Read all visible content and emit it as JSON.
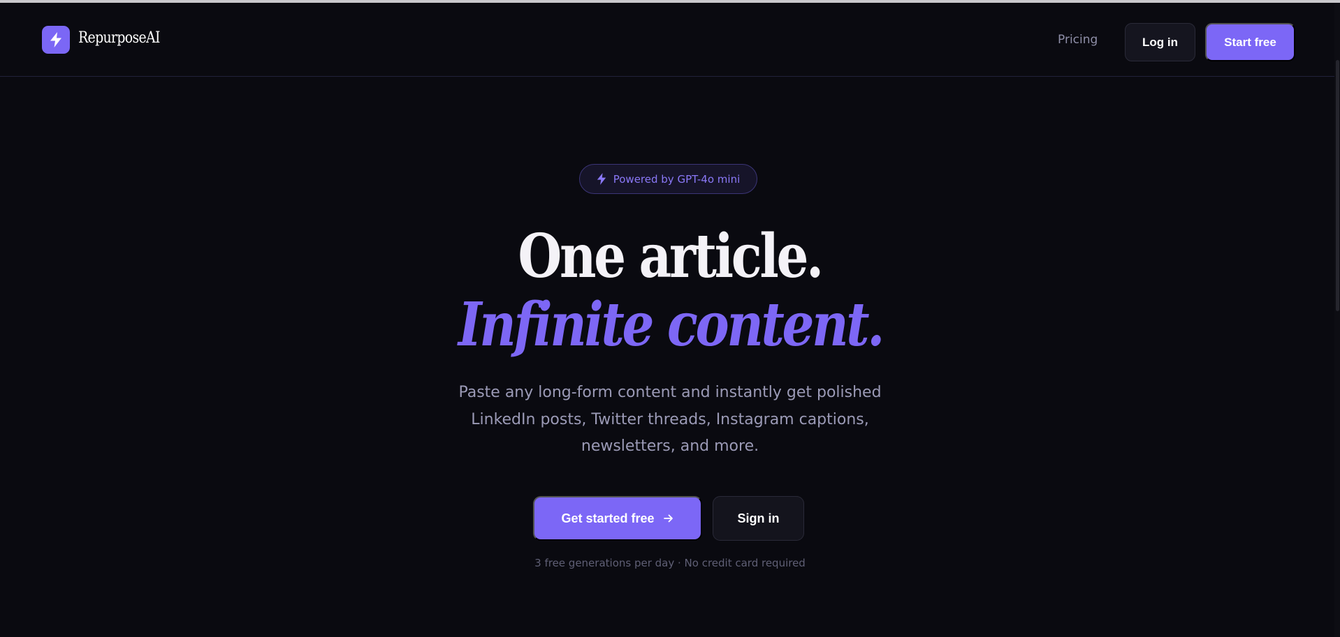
{
  "header": {
    "brand": "RepurposeAI",
    "logo_icon": "lightning-bolt-icon",
    "nav_pricing": "Pricing",
    "login_label": "Log in",
    "start_label": "Start free"
  },
  "hero": {
    "badge_icon": "lightning-bolt-icon",
    "badge_text": "Powered by GPT-4o mini",
    "headline_line1": "One article.",
    "headline_line2": "Infinite content.",
    "subtitle": "Paste any long-form content and instantly get polished LinkedIn posts, Twitter threads, Instagram captions, newsletters, and more.",
    "cta_primary_label": "Get started free",
    "cta_primary_icon": "arrow-right-icon",
    "cta_secondary_label": "Sign in",
    "footnote": "3 free generations per day · No credit card required"
  },
  "colors": {
    "background": "#0a0a10",
    "accent": "#7c67f6",
    "text_primary": "#f4f2f7",
    "text_muted": "#9b9ab6"
  }
}
